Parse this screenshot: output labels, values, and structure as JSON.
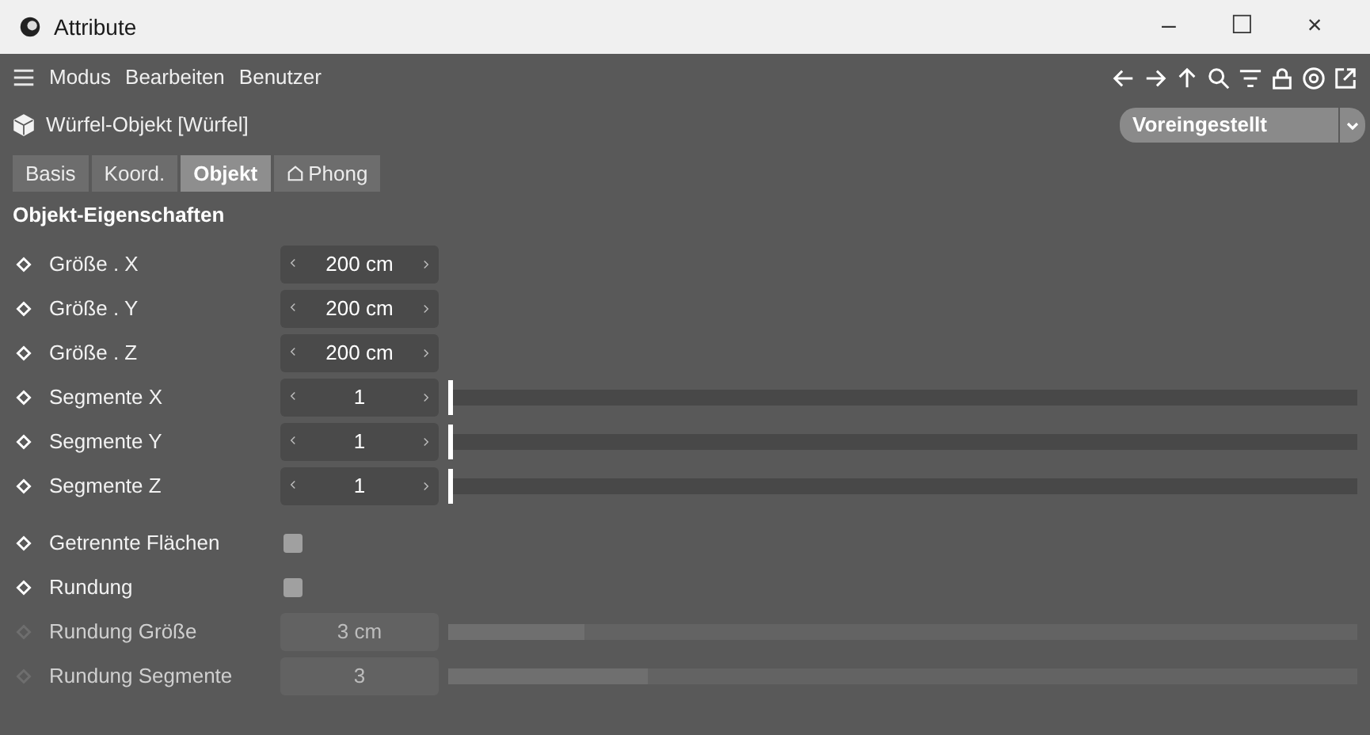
{
  "window": {
    "title": "Attribute",
    "controls": [
      "–",
      "☐",
      "×"
    ]
  },
  "menu": [
    "Modus",
    "Bearbeiten",
    "Benutzer"
  ],
  "object": {
    "title": "Würfel-Objekt [Würfel]"
  },
  "preset": {
    "value": "Voreingestellt"
  },
  "tabs": [
    {
      "label": "Basis",
      "selected": false
    },
    {
      "label": "Koord.",
      "selected": false
    },
    {
      "label": "Objekt",
      "selected": true
    },
    {
      "label": "Phong",
      "selected": false
    }
  ],
  "section": "Objekt-Eigenschaften",
  "rows": [
    {
      "kind": "number",
      "label": "Größe . X",
      "value": "200 cm",
      "disabled": false
    },
    {
      "kind": "number",
      "label": "Größe . Y",
      "value": "200 cm",
      "disabled": false
    },
    {
      "kind": "number",
      "label": "Größe . Z",
      "value": "200 cm",
      "disabled": false
    },
    {
      "kind": "slider",
      "label": "Segmente X",
      "value": "1",
      "level": 0,
      "disabled": false
    },
    {
      "kind": "slider",
      "label": "Segmente Y",
      "value": "1",
      "level": 0,
      "disabled": false
    },
    {
      "kind": "slider",
      "label": "Segmente Z",
      "value": "1",
      "level": 0,
      "disabled": false
    },
    {
      "kind": "checkbox",
      "label": "Getrennte Flächen",
      "checked": false,
      "disabled": false
    },
    {
      "kind": "checkbox",
      "label": "Rundung",
      "checked": false,
      "disabled": false
    },
    {
      "kind": "slider",
      "label": "Rundung Größe",
      "value": "3 cm",
      "level": 0.15,
      "disabled": true
    },
    {
      "kind": "slider",
      "label": "Rundung Segmente",
      "value": "3",
      "level": 0.22,
      "disabled": true
    }
  ]
}
